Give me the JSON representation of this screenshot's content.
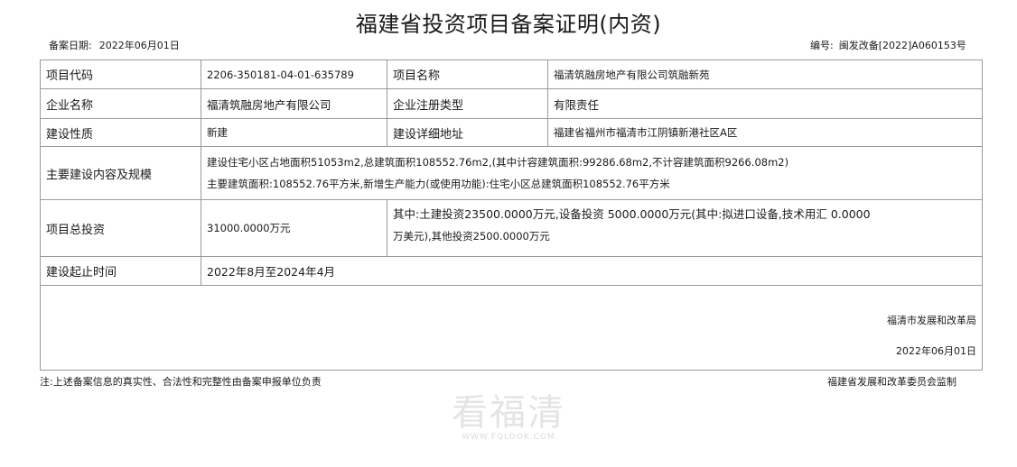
{
  "doc": {
    "title": "福建省投资项目备案证明(内资)",
    "filing_date_label": "备案日期:",
    "filing_date": "2022年06月01日",
    "number_label": "编号:",
    "number": "闽发改备[2022]A060153号"
  },
  "rows": {
    "project_code_label": "项目代码",
    "project_code": "2206-350181-04-01-635789",
    "project_name_label": "项目名称",
    "project_name": "福清筑融房地产有限公司筑融新苑",
    "company_label": "企业名称",
    "company": "福清筑融房地产有限公司",
    "reg_type_label": "企业注册类型",
    "reg_type": "有限责任",
    "nature_label": "建设性质",
    "nature": "新建",
    "address_label": "建设详细地址",
    "address": "福建省福州市福清市江阴镇新港社区A区",
    "scope_label": "主要建设内容及规模",
    "scope_line1": "建设住宅小区占地面积51053m2,总建筑面积108552.76m2,(其中计容建筑面积:99286.68m2,不计容建筑面积9266.08m2)",
    "scope_line2": "主要建筑面积:108552.76平方米,新增生产能力(或使用功能):住宅小区总建筑面积108552.76平方米",
    "investment_label": "项目总投资",
    "investment_total": "31000.0000万元",
    "investment_detail_line1": "其中:土建投资23500.0000万元,设备投资 5000.0000万元(其中:拟进口设备,技术用汇 0.0000",
    "investment_detail_line2": "万美元),其他投资2500.0000万元",
    "period_label": "建设起止时间",
    "period": "2022年8月至2024年4月"
  },
  "signature": {
    "org": "福清市发展和改革局",
    "date": "2022年06月01日"
  },
  "footer": {
    "note": "注:上述备案信息的真实性、合法性和完整性由备案申报单位负责",
    "supervisor": "福建省发展和改革委员会监制"
  },
  "watermark": {
    "cn": "看福清",
    "en": "WWW.FQLOOK.COM"
  }
}
